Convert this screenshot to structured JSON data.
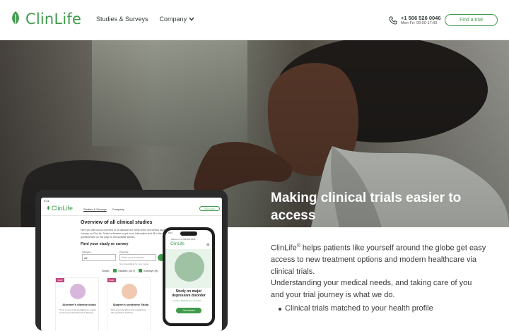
{
  "header": {
    "logo_text": "ClinLife",
    "nav": [
      {
        "label": "Studies & Surveys"
      },
      {
        "label": "Company"
      }
    ],
    "phone_number": "+1 506 526 0046",
    "phone_hours": "Mon-Fri: 09:00-17:00",
    "find_trial_label": "Find a trial"
  },
  "hero": {
    "title": "Making clinical trials easier to access"
  },
  "intro": {
    "brand": "ClinLife",
    "registered": "®",
    "text1": " helps patients like yourself around the globe get easy access to new treatment options and modern healthcare via clinical trials.",
    "text2": "Understanding your medical needs, and taking care of you and your trial journey is what we do.",
    "bullets": [
      "Clinical trials matched to your health profile"
    ]
  },
  "tablet": {
    "status_time": "9:41",
    "logo": "ClinLife",
    "nav1": "Studies & Surveys",
    "nav2": "Company",
    "btn": "Find a trial",
    "heading": "Overview of all clinical studies",
    "para": "Here you will find an overview of all diseases for which there are clinical studies and surveys on ClinLife. Select a disease to get more information and fill in the relevant questionnaire on this page to find suitable studies.",
    "find_heading": "Find your study or survey",
    "indication_label": "Indication",
    "indication_value": "All",
    "postcode_label": "Postcode",
    "postcode_placeholder": "Enter your postcode",
    "postcode_note": "Not all available for your region",
    "show_label": "Show:",
    "studies_label": "Studies (147)",
    "surveys_label": "Surveys (9)",
    "cards": [
      {
        "tag": "Study",
        "title": "Alzeimer's disease study",
        "text": "If you or one of your relatives is a carer of someone with Alzeimer's disease..."
      },
      {
        "tag": "Study",
        "title": "Sjogren's syndrome Study",
        "text": "Find out more about new research on this syndrome and how..."
      }
    ]
  },
  "phone": {
    "status_time": "9:41",
    "call_text": "Call us on +1 506 526 0046",
    "logo": "ClinLife",
    "title": "Study on major depressive disorder",
    "location": "London, Manchester + 5 more",
    "cta": "Get started"
  },
  "colors": {
    "brand_green": "#3f9b4a",
    "tag_pink": "#c2477d"
  }
}
